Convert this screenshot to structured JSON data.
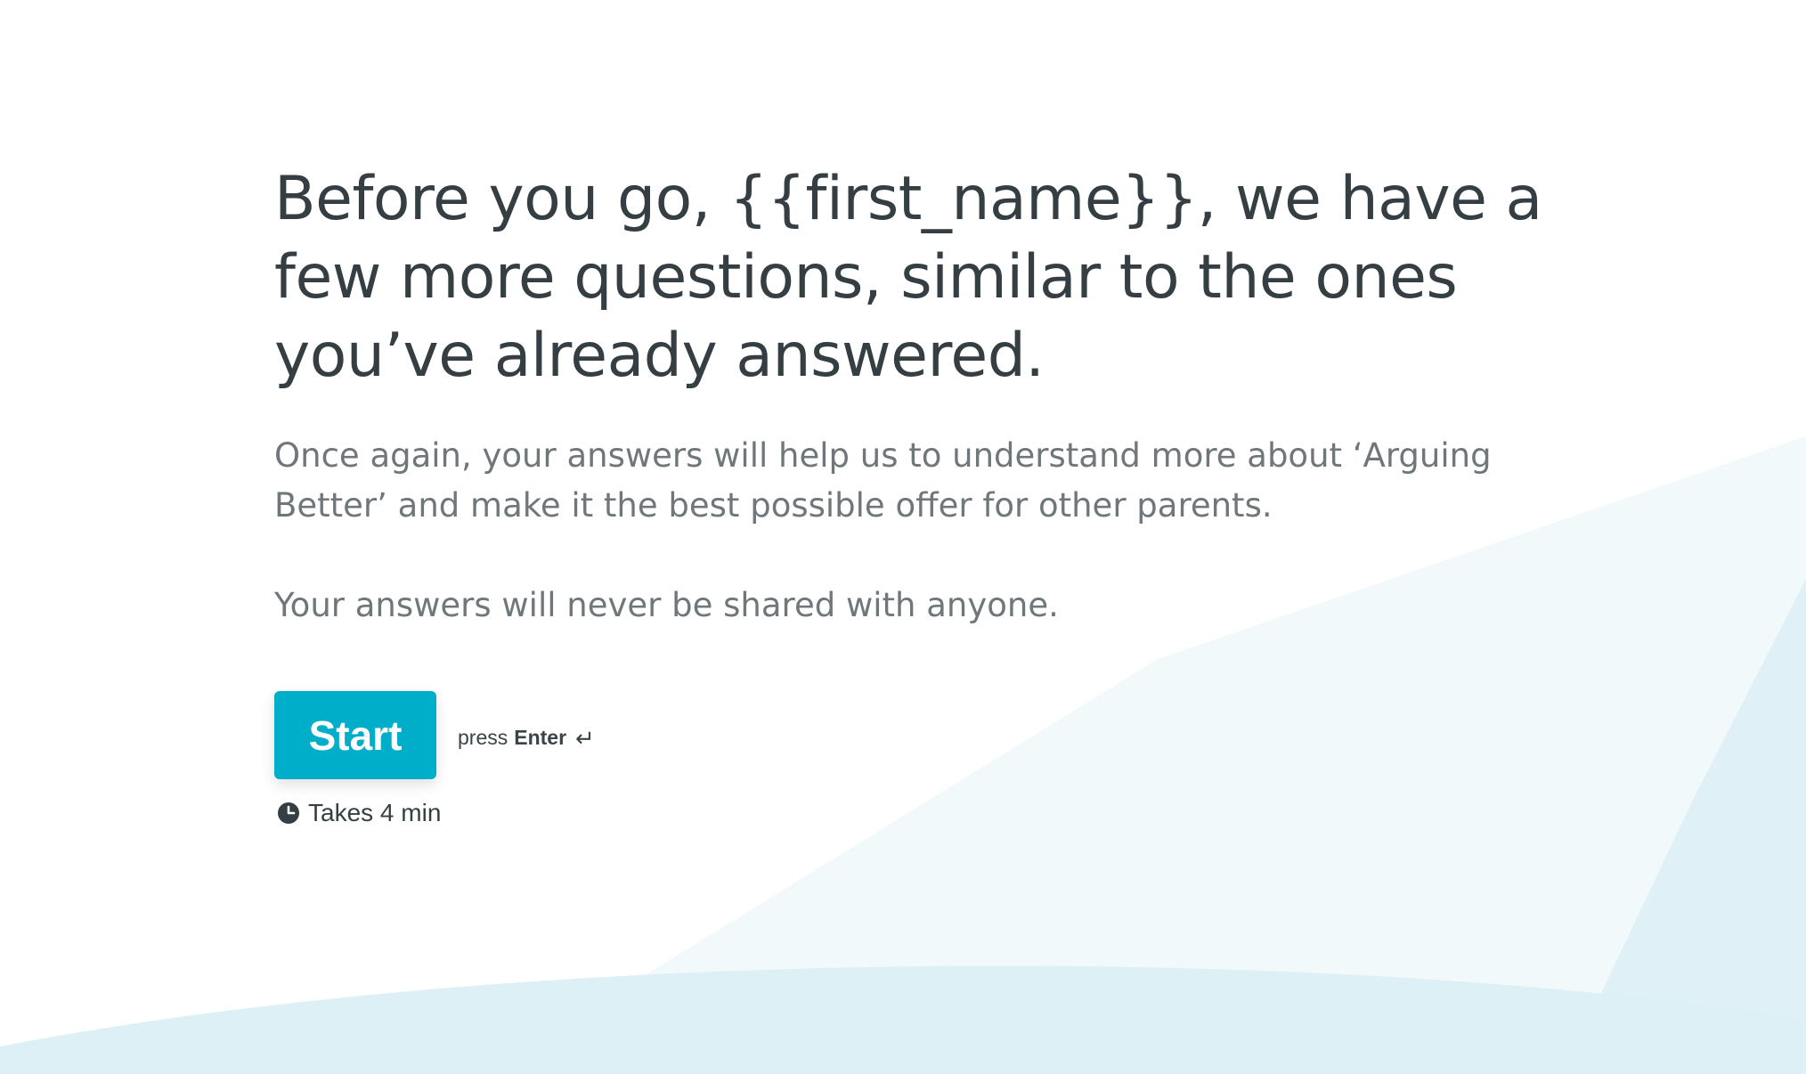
{
  "welcome": {
    "heading": "Before you go, {{first_name}}, we have a few more questions, similar to the ones you’ve already answered.",
    "description_line1": "Once again, your answers will help us to understand more about ‘Arguing Better’ and make it the best possible offer for other parents.",
    "description_line2": "Your answers will never be shared with anyone.",
    "start_button_label": "Start",
    "hint_prefix": "press",
    "hint_key": "Enter",
    "hint_icon": "↵",
    "duration_icon": "clock-icon",
    "duration_text": "Takes 4 min"
  },
  "colors": {
    "accent": "#00aec9",
    "heading_text": "#353f43",
    "body_text": "#6f777b",
    "background_shape_light": "#eef7fa",
    "background_shape_medium": "#dcf0f5"
  }
}
